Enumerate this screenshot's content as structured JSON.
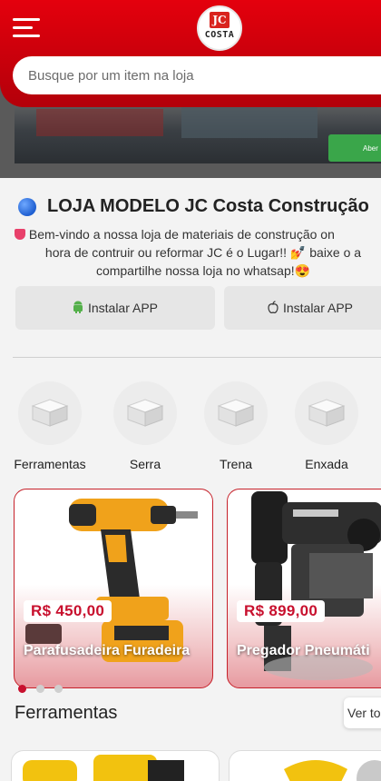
{
  "header": {
    "logo_top": "JC",
    "logo_bottom": "COSTA",
    "search_placeholder": "Busque por um item na loja"
  },
  "banner": {
    "button_text": "Aber"
  },
  "store": {
    "title": "LOJA MODELO JC Costa Construção",
    "description_line1": "Bem-vindo a nossa loja de materiais de construção on",
    "description_line2": "hora de contruir ou reformar JC é o Lugar!! 💅 baixe o a",
    "description_line3": "compartilhe nossa loja no whatsap!😍"
  },
  "install": {
    "android_label": "Instalar APP",
    "apple_label": "Instalar APP"
  },
  "categories": [
    {
      "label": "Ferramentas"
    },
    {
      "label": "Serra"
    },
    {
      "label": "Trena"
    },
    {
      "label": "Enxada"
    }
  ],
  "products": [
    {
      "price": "R$ 450,00",
      "name": "Parafusadeira Furadeira"
    },
    {
      "price": "R$ 899,00",
      "name": "Pregador Pneumáti"
    }
  ],
  "carousel": {
    "active_dot": 1,
    "dot_count": 3
  },
  "section": {
    "title": "Ferramentas",
    "see_all": "Ver to"
  },
  "colors": {
    "brand_red": "#d9000c",
    "price_red": "#c8102e",
    "android_green": "#54b04a"
  },
  "icons": {
    "menu": "menu-icon",
    "android": "android-icon",
    "apple": "apple-icon",
    "category": "box-icon",
    "globe": "globe-icon"
  }
}
